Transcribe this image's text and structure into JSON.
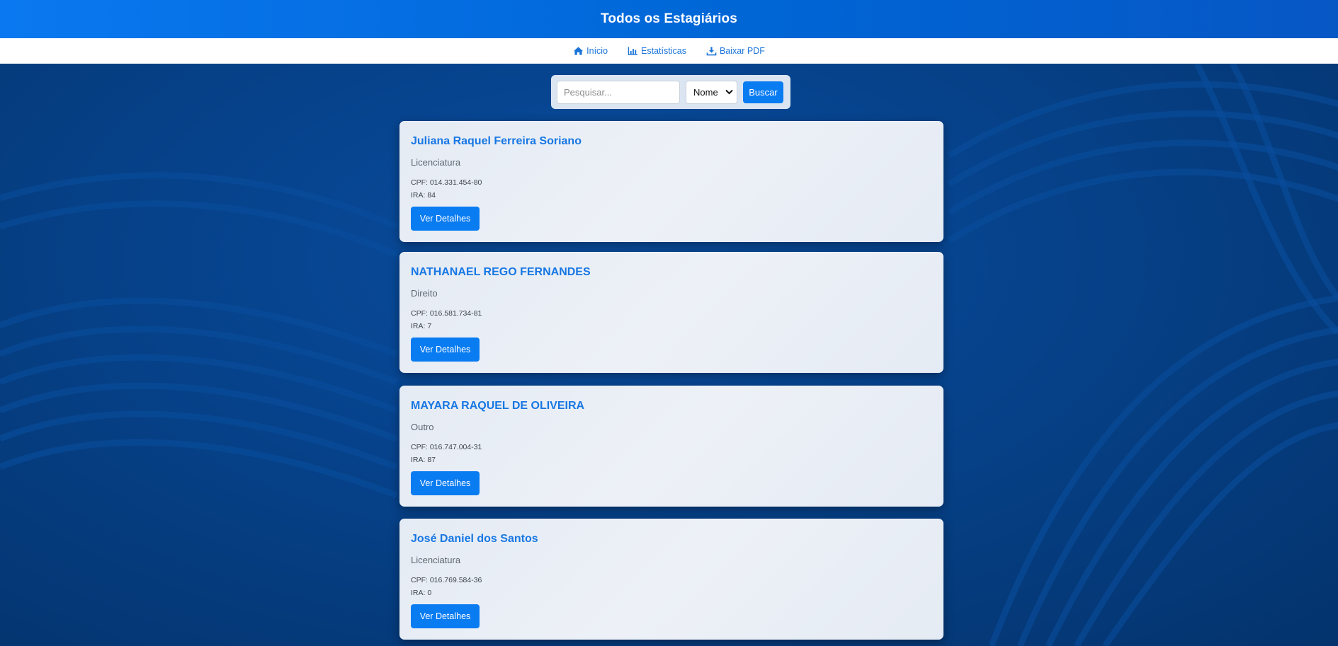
{
  "header": {
    "title": "Todos os Estagiários"
  },
  "nav": {
    "items": [
      {
        "label": "Início",
        "icon": "home-icon"
      },
      {
        "label": "Estatísticas",
        "icon": "chart-icon"
      },
      {
        "label": "Baixar PDF",
        "icon": "download-icon"
      }
    ]
  },
  "search": {
    "placeholder": "Pesquisar...",
    "value": "",
    "filter_selected": "Nome",
    "button_label": "Buscar"
  },
  "interns": [
    {
      "name": "Juliana Raquel Ferreira Soriano",
      "course": "Licenciatura",
      "cpf": "CPF: 014.331.454-80",
      "ira": "IRA: 84",
      "button": "Ver Detalhes"
    },
    {
      "name": "NATHANAEL REGO FERNANDES",
      "course": "Direito",
      "cpf": "CPF: 016.581.734-81",
      "ira": "IRA: 7",
      "button": "Ver Detalhes"
    },
    {
      "name": "MAYARA RAQUEL DE OLIVEIRA",
      "course": "Outro",
      "cpf": "CPF: 016.747.004-31",
      "ira": "IRA: 87",
      "button": "Ver Detalhes"
    },
    {
      "name": "José Daniel dos Santos",
      "course": "Licenciatura",
      "cpf": "CPF: 016.769.584-36",
      "ira": "IRA: 0",
      "button": "Ver Detalhes"
    }
  ],
  "colors": {
    "header_bg": "#0a78f0",
    "page_bg": "#053f85",
    "accent": "#0a7cf2",
    "name_text": "#1777e3",
    "card_bg": "#e9eef5"
  }
}
